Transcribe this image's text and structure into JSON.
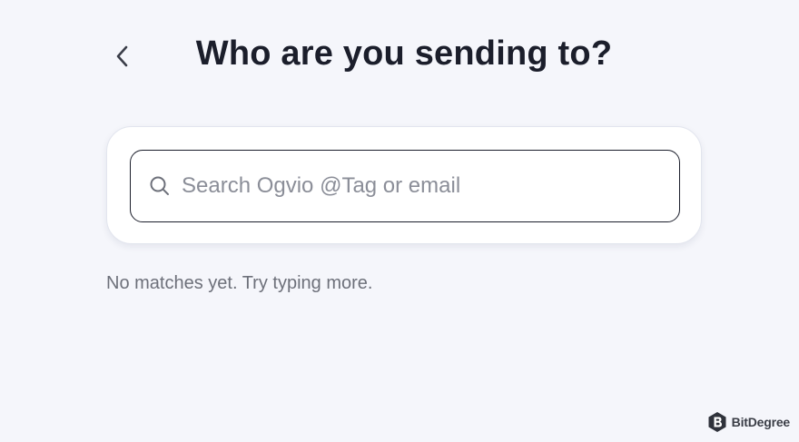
{
  "header": {
    "title": "Who are you sending to?",
    "back_icon": "chevron-left-icon"
  },
  "search": {
    "placeholder": "Search Ogvio @Tag or email",
    "value": "",
    "icon": "search-icon"
  },
  "results": {
    "empty_message": "No matches yet. Try typing more."
  },
  "watermark": {
    "text": "BitDegree",
    "logo": "bitdegree-logo"
  },
  "colors": {
    "background": "#f5f6fb",
    "text_primary": "#1b1e2b",
    "text_muted": "#6d707a",
    "placeholder": "#8b8e98",
    "card": "#ffffff"
  }
}
